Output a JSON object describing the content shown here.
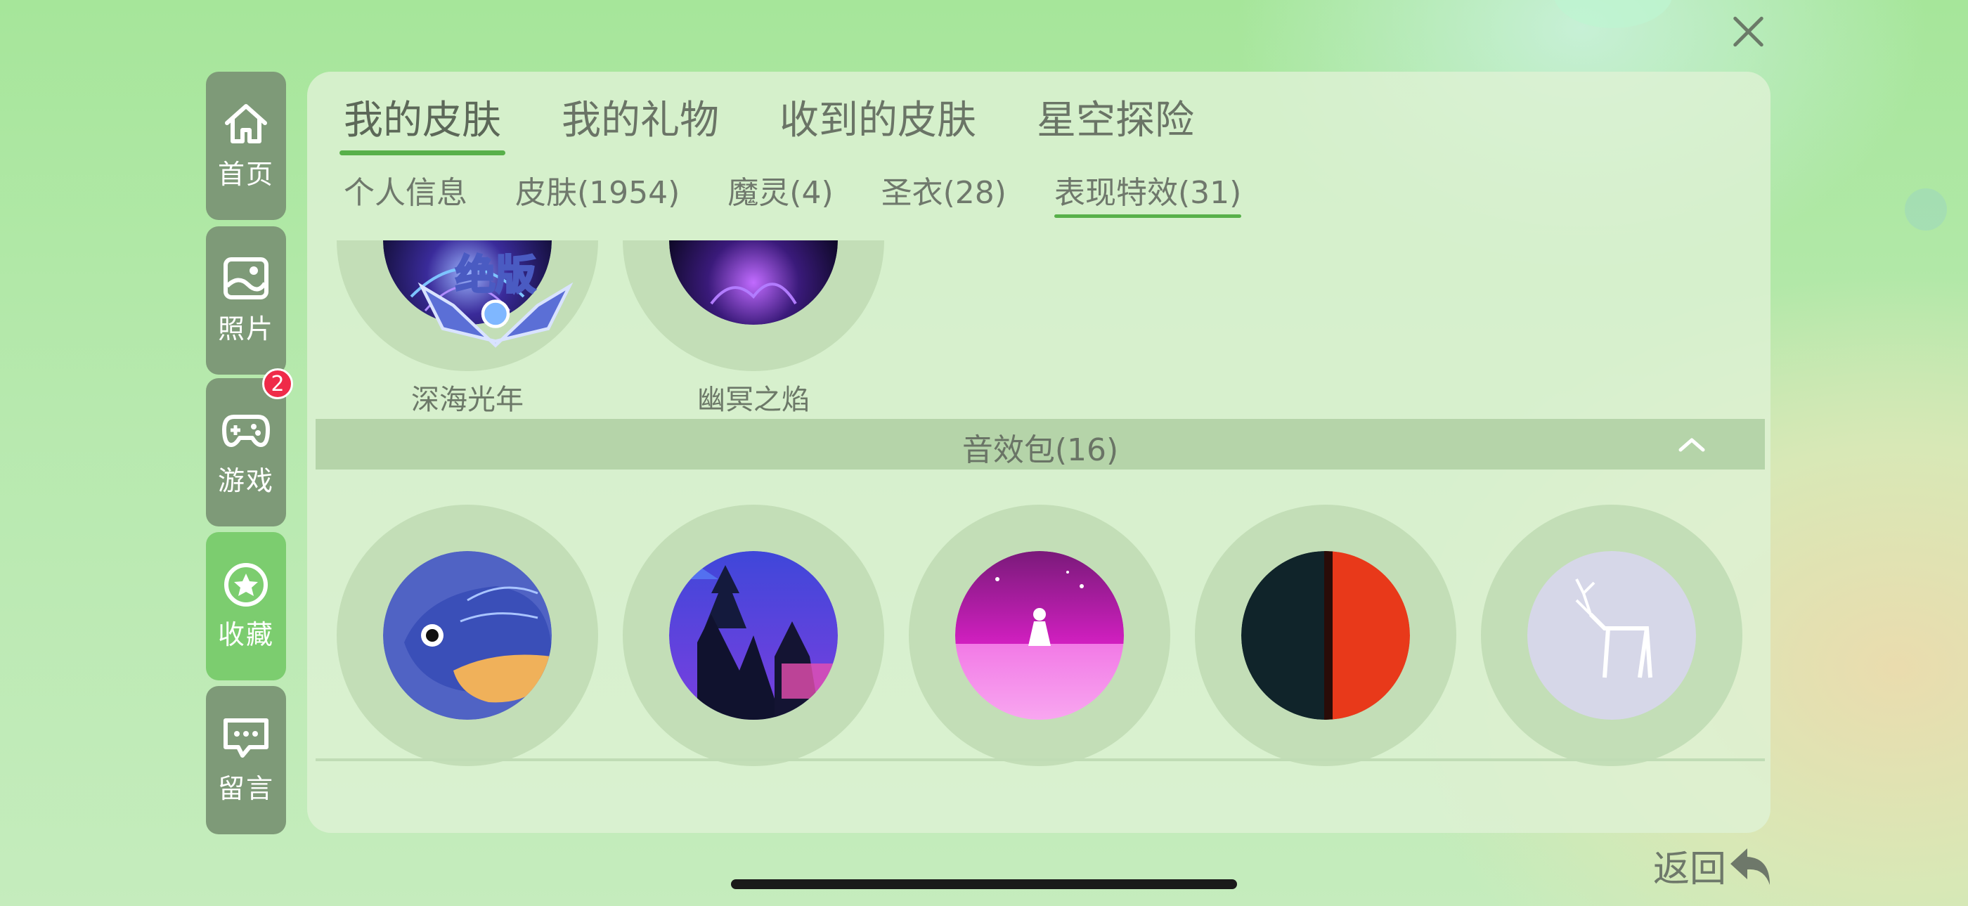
{
  "top_tabs": [
    {
      "label": "我的皮肤",
      "active": true
    },
    {
      "label": "我的礼物",
      "active": false
    },
    {
      "label": "收到的皮肤",
      "active": false
    },
    {
      "label": "星空探险",
      "active": false
    }
  ],
  "sub_tabs": [
    {
      "label": "个人信息",
      "active": false
    },
    {
      "label": "皮肤(1954)",
      "active": false
    },
    {
      "label": "魔灵(4)",
      "active": false
    },
    {
      "label": "圣衣(28)",
      "active": false
    },
    {
      "label": "表现特效(31)",
      "active": true
    }
  ],
  "sidebar": {
    "items": [
      {
        "label": "首页",
        "icon": "home-icon"
      },
      {
        "label": "照片",
        "icon": "photo-icon"
      },
      {
        "label": "游戏",
        "icon": "gamepad-icon",
        "badge": "2"
      },
      {
        "label": "收藏",
        "icon": "star-icon",
        "active": true
      },
      {
        "label": "留言",
        "icon": "message-icon"
      }
    ]
  },
  "effects_section": {
    "items": [
      {
        "name": "深海光年",
        "tag": "绝版"
      },
      {
        "name": "幽冥之焰"
      }
    ]
  },
  "sound_section": {
    "title": "音效包(16)",
    "items": [
      {
        "thumb": "fish"
      },
      {
        "thumb": "forest"
      },
      {
        "thumb": "girl-pink"
      },
      {
        "thumb": "dark-red"
      },
      {
        "thumb": "deer"
      }
    ]
  },
  "back_label": "返回",
  "colors": {
    "accent": "#58b04a",
    "sidebar": "#7e9a78",
    "sidebar_active": "#7ccd6f",
    "badge": "#ef2b49"
  }
}
